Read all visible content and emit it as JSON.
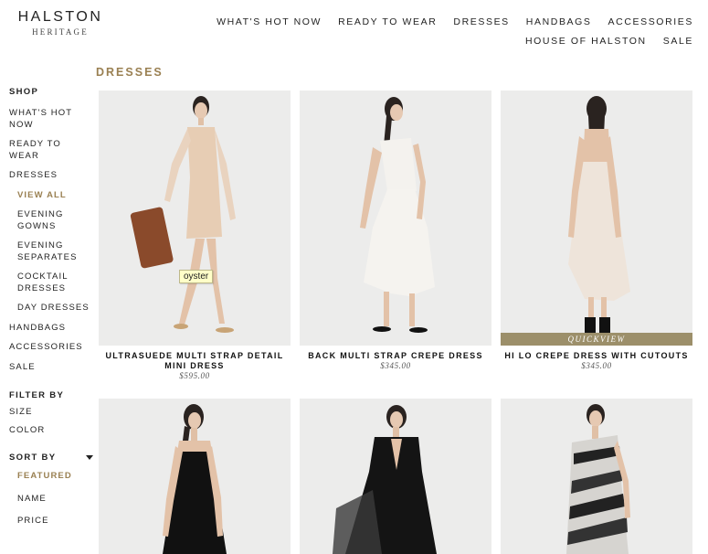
{
  "brand": {
    "name": "HALSTON",
    "sub": "HERITAGE"
  },
  "topnav": {
    "row1": [
      "WHAT'S HOT NOW",
      "READY TO WEAR",
      "DRESSES",
      "HANDBAGS",
      "ACCESSORIES"
    ],
    "row2": [
      "HOUSE OF HALSTON",
      "SALE"
    ]
  },
  "page_title": "DRESSES",
  "sidebar": {
    "shop_heading": "SHOP",
    "whats_hot": "WHAT'S HOT NOW",
    "ready_to_wear": "READY TO WEAR",
    "dresses": "DRESSES",
    "dresses_sub": {
      "view_all": "VIEW ALL",
      "evening_gowns": "EVENING GOWNS",
      "evening_separates": "EVENING SEPARATES",
      "cocktail_dresses": "COCKTAIL DRESSES",
      "day_dresses": "DAY DRESSES"
    },
    "handbags": "HANDBAGS",
    "accessories": "ACCESSORIES",
    "sale": "SALE",
    "filter_heading": "FILTER BY",
    "filter_size": "SIZE",
    "filter_color": "COLOR",
    "sort_heading": "SORT BY",
    "sort_featured": "FEATURED",
    "sort_name": "NAME",
    "sort_price": "PRICE"
  },
  "products": [
    {
      "name": "ULTRASUEDE MULTI STRAP DETAIL MINI DRESS",
      "price": "$595.00",
      "tooltip": "oyster"
    },
    {
      "name": "BACK MULTI STRAP CREPE DRESS",
      "price": "$345.00"
    },
    {
      "name": "HI LO CREPE DRESS WITH CUTOUTS",
      "price": "$345.00",
      "quickview": "QUICKVIEW"
    },
    {},
    {},
    {}
  ],
  "colors": {
    "accent": "#9a8052",
    "quickview_bg": "#9c8f6a",
    "photo_bg": "#ececeb"
  },
  "icons": {
    "sort_caret": "caret-down-icon"
  }
}
